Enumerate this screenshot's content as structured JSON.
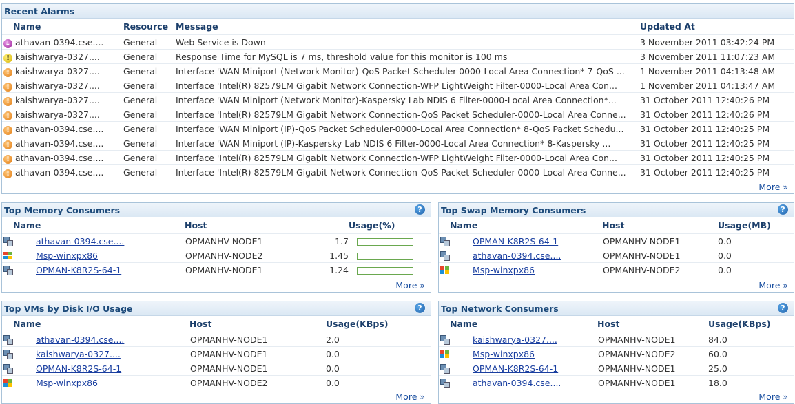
{
  "recent_alarms": {
    "title": "Recent Alarms",
    "columns": [
      "Name",
      "Resource",
      "Message",
      "Updated At"
    ],
    "rows": [
      {
        "severity": "down",
        "name": "athavan-0394.cse....",
        "resource": "General",
        "message": "Web Service is Down",
        "updated": "3 November 2011 03:42:24 PM"
      },
      {
        "severity": "critical",
        "name": "kaishwarya-0327....",
        "resource": "General",
        "message": "Response Time for MySQL is 7 ms, threshold value for this monitor is 100 ms",
        "updated": "3 November 2011 11:07:23 AM"
      },
      {
        "severity": "warning",
        "name": "kaishwarya-0327....",
        "resource": "General",
        "message": "Interface 'WAN Miniport (Network Monitor)-QoS Packet Scheduler-0000-Local Area Connection* 7-QoS ...",
        "updated": "1 November 2011 04:13:48 AM"
      },
      {
        "severity": "warning",
        "name": "kaishwarya-0327....",
        "resource": "General",
        "message": "Interface 'Intel(R) 82579LM Gigabit Network Connection-WFP LightWeight Filter-0000-Local Area Con...",
        "updated": "1 November 2011 04:13:47 AM"
      },
      {
        "severity": "warning",
        "name": "kaishwarya-0327....",
        "resource": "General",
        "message": "Interface 'WAN Miniport (Network Monitor)-Kaspersky Lab NDIS 6 Filter-0000-Local Area Connection*...",
        "updated": "31 October 2011 12:40:26 PM"
      },
      {
        "severity": "warning",
        "name": "kaishwarya-0327....",
        "resource": "General",
        "message": "Interface 'Intel(R) 82579LM Gigabit Network Connection-QoS Packet Scheduler-0000-Local Area Conne...",
        "updated": "31 October 2011 12:40:26 PM"
      },
      {
        "severity": "warning",
        "name": "athavan-0394.cse....",
        "resource": "General",
        "message": "Interface 'WAN Miniport (IP)-QoS Packet Scheduler-0000-Local Area Connection* 8-QoS Packet Schedu...",
        "updated": "31 October 2011 12:40:25 PM"
      },
      {
        "severity": "warning",
        "name": "athavan-0394.cse....",
        "resource": "General",
        "message": "Interface 'WAN Miniport (IP)-Kaspersky Lab NDIS 6 Filter-0000-Local Area Connection* 8-Kaspersky ...",
        "updated": "31 October 2011 12:40:25 PM"
      },
      {
        "severity": "warning",
        "name": "athavan-0394.cse....",
        "resource": "General",
        "message": "Interface 'Intel(R) 82579LM Gigabit Network Connection-WFP LightWeight Filter-0000-Local Area Con...",
        "updated": "31 October 2011 12:40:25 PM"
      },
      {
        "severity": "warning",
        "name": "athavan-0394.cse....",
        "resource": "General",
        "message": "Interface 'Intel(R) 82579LM Gigabit Network Connection-QoS Packet Scheduler-0000-Local Area Conne...",
        "updated": "31 October 2011 12:40:25 PM"
      }
    ],
    "more": "More »"
  },
  "top_memory": {
    "title": "Top Memory Consumers",
    "columns": [
      "Name",
      "Host",
      "Usage(%)"
    ],
    "rows": [
      {
        "icon": "vm",
        "name": "athavan-0394.cse....",
        "host": "OPMANHV-NODE1",
        "usage": "1.7",
        "fill": 0.017
      },
      {
        "icon": "windows",
        "name": "Msp-winxpx86",
        "host": "OPMANHV-NODE2",
        "usage": "1.45",
        "fill": 0.0145
      },
      {
        "icon": "vm",
        "name": "OPMAN-K8R2S-64-1",
        "host": "OPMANHV-NODE1",
        "usage": "1.24",
        "fill": 0.0124
      }
    ],
    "more": "More »"
  },
  "top_swap": {
    "title": "Top Swap Memory Consumers",
    "columns": [
      "Name",
      "Host",
      "Usage(MB)"
    ],
    "rows": [
      {
        "icon": "vm",
        "name": "OPMAN-K8R2S-64-1",
        "host": "OPMANHV-NODE1",
        "usage": "0.0"
      },
      {
        "icon": "vm",
        "name": "athavan-0394.cse....",
        "host": "OPMANHV-NODE1",
        "usage": "0.0"
      },
      {
        "icon": "windows",
        "name": "Msp-winxpx86",
        "host": "OPMANHV-NODE2",
        "usage": "0.0"
      }
    ],
    "more": "More »"
  },
  "top_disk": {
    "title": "Top VMs by Disk I/O Usage",
    "columns": [
      "Name",
      "Host",
      "Usage(KBps)"
    ],
    "rows": [
      {
        "icon": "vm",
        "name": "athavan-0394.cse....",
        "host": "OPMANHV-NODE1",
        "usage": "2.0"
      },
      {
        "icon": "vm",
        "name": "kaishwarya-0327....",
        "host": "OPMANHV-NODE1",
        "usage": "0.0"
      },
      {
        "icon": "vm",
        "name": "OPMAN-K8R2S-64-1",
        "host": "OPMANHV-NODE1",
        "usage": "0.0"
      },
      {
        "icon": "windows",
        "name": "Msp-winxpx86",
        "host": "OPMANHV-NODE2",
        "usage": "0.0"
      }
    ],
    "more": "More »"
  },
  "top_network": {
    "title": "Top Network Consumers",
    "columns": [
      "Name",
      "Host",
      "Usage(KBps)"
    ],
    "rows": [
      {
        "icon": "vm",
        "name": "kaishwarya-0327....",
        "host": "OPMANHV-NODE1",
        "usage": "84.0"
      },
      {
        "icon": "windows",
        "name": "Msp-winxpx86",
        "host": "OPMANHV-NODE2",
        "usage": "60.0"
      },
      {
        "icon": "vm",
        "name": "OPMAN-K8R2S-64-1",
        "host": "OPMANHV-NODE1",
        "usage": "25.0"
      },
      {
        "icon": "vm",
        "name": "athavan-0394.cse....",
        "host": "OPMANHV-NODE1",
        "usage": "18.0"
      }
    ],
    "more": "More »"
  },
  "help_glyph": "?",
  "icons": {
    "down": "arrow-down-alarm-icon",
    "critical": "critical-alarm-icon",
    "warning": "warning-alarm-icon",
    "vm": "virtual-machine-icon",
    "windows": "windows-logo-icon"
  }
}
